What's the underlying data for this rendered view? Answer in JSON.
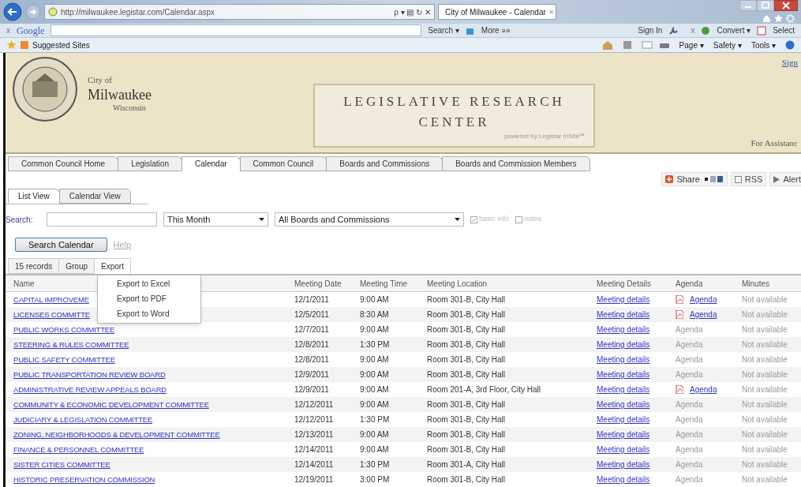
{
  "browser": {
    "url": "http://milwaukee.legistar.com/Calendar.aspx",
    "address_tools": "ρ ▾ ▤ ↻ ✕",
    "tab_title": "City of Milwaukee - Calendar",
    "tab_close": "×"
  },
  "google_toolbar": {
    "close": "x",
    "brand": "Google",
    "search_button": "Search ▾",
    "more": "More »»",
    "sign_in": "Sign In",
    "close_right": "x",
    "convert": "Convert ▾",
    "select": "Select"
  },
  "favorites_bar": {
    "suggested_sites": "Suggested Sites",
    "commands": [
      "Page ▾",
      "Safety ▾",
      "Tools ▾"
    ]
  },
  "banner": {
    "city_of": "City of",
    "city": "Milwaukee",
    "state": "Wisconsin",
    "title_line1": "LEGISLATIVE RESEARCH",
    "title_line2": "CENTER",
    "powered_by": "powered by Legistar InSite℠",
    "sign_in": "Sign",
    "assistance": "For Assistanc"
  },
  "nav_tabs": [
    {
      "label": "Common Council Home",
      "selected": false
    },
    {
      "label": "Legislation",
      "selected": false
    },
    {
      "label": "Calendar",
      "selected": true
    },
    {
      "label": "Common Council",
      "selected": false
    },
    {
      "label": "Boards and Commissions",
      "selected": false
    },
    {
      "label": "Boards and Commission Members",
      "selected": false
    }
  ],
  "share_bar": {
    "share": "Share",
    "rss": "RSS",
    "alerts": "Alert"
  },
  "view_tabs": [
    {
      "label": "List View",
      "selected": true
    },
    {
      "label": "Calendar View",
      "selected": false
    }
  ],
  "search": {
    "label": "Search:",
    "period": "This Month",
    "body": "All Boards and Commissions",
    "basic_info": {
      "label": "basic info",
      "checked": true
    },
    "notes": {
      "label": "notes",
      "checked": false
    },
    "button": "Search Calendar",
    "help": "Help"
  },
  "grid_toolbar": [
    {
      "label": "15 records",
      "selected": false
    },
    {
      "label": "Group",
      "selected": false
    },
    {
      "label": "Export",
      "selected": true
    }
  ],
  "export_menu": [
    "Export to Excel",
    "Export to PDF",
    "Export to Word"
  ],
  "table": {
    "columns": [
      "Name",
      "Meeting Date",
      "Meeting Time",
      "Meeting Location",
      "Meeting Details",
      "Agenda",
      "Minutes"
    ],
    "rows": [
      {
        "name": "CAPITAL IMPROVEME",
        "date": "12/1/2011",
        "time": "9:00 AM",
        "location": "Room 301-B, City Hall",
        "details": "Meeting details",
        "agenda": "Agenda",
        "agenda_available": true,
        "minutes": "Not available"
      },
      {
        "name": "LICENSES COMMITTE",
        "date": "12/5/2011",
        "time": "8:30 AM",
        "location": "Room 301-B, City Hall",
        "details": "Meeting details",
        "agenda": "Agenda",
        "agenda_available": true,
        "minutes": "Not available"
      },
      {
        "name": "PUBLIC WORKS COMMITTEE",
        "date": "12/7/2011",
        "time": "9:00 AM",
        "location": "Room 301-B, City Hall",
        "details": "Meeting details",
        "agenda": "Agenda",
        "agenda_available": false,
        "minutes": "Not available"
      },
      {
        "name": "STEERING & RULES COMMITTEE",
        "date": "12/8/2011",
        "time": "1:30 PM",
        "location": "Room 301-B, City Hall",
        "details": "Meeting details",
        "agenda": "Agenda",
        "agenda_available": false,
        "minutes": "Not available"
      },
      {
        "name": "PUBLIC SAFETY COMMITTEE",
        "date": "12/8/2011",
        "time": "9:00 AM",
        "location": "Room 301-B, City Hall",
        "details": "Meeting details",
        "agenda": "Agenda",
        "agenda_available": false,
        "minutes": "Not available"
      },
      {
        "name": "PUBLIC TRANSPORTATION REVIEW BOARD",
        "date": "12/9/2011",
        "time": "9:00 AM",
        "location": "Room 301-B, City Hall",
        "details": "Meeting details",
        "agenda": "Agenda",
        "agenda_available": false,
        "minutes": "Not available"
      },
      {
        "name": "ADMINISTRATIVE REVIEW APPEALS BOARD",
        "date": "12/9/2011",
        "time": "9:00 AM",
        "location": "Room 201-A, 3rd Floor, City Hall",
        "details": "Meeting details",
        "agenda": "Agenda",
        "agenda_available": true,
        "minutes": "Not available"
      },
      {
        "name": "COMMUNITY & ECONOMIC DEVELOPMENT COMMITTEE",
        "date": "12/12/2011",
        "time": "9:00 AM",
        "location": "Room 301-B, City Hall",
        "details": "Meeting details",
        "agenda": "Agenda",
        "agenda_available": false,
        "minutes": "Not available"
      },
      {
        "name": "JUDICIARY & LEGISLATION COMMITTEE",
        "date": "12/12/2011",
        "time": "1:30 PM",
        "location": "Room 301-B, City Hall",
        "details": "Meeting details",
        "agenda": "Agenda",
        "agenda_available": false,
        "minutes": "Not available"
      },
      {
        "name": "ZONING, NEIGHBORHOODS & DEVELOPMENT COMMITTEE",
        "date": "12/13/2011",
        "time": "9:00 AM",
        "location": "Room 301-B, City Hall",
        "details": "Meeting details",
        "agenda": "Agenda",
        "agenda_available": false,
        "minutes": "Not available"
      },
      {
        "name": "FINANCE & PERSONNEL COMMITTEE",
        "date": "12/14/2011",
        "time": "9:00 AM",
        "location": "Room 301-B, City Hall",
        "details": "Meeting details",
        "agenda": "Agenda",
        "agenda_available": false,
        "minutes": "Not available"
      },
      {
        "name": "SISTER CITIES COMMITTEE",
        "date": "12/14/2011",
        "time": "1:30 PM",
        "location": "Room 301-A, City Hall",
        "details": "Meeting details",
        "agenda": "Agenda",
        "agenda_available": false,
        "minutes": "Not available"
      },
      {
        "name": "HISTORIC PRESERVATION COMMISSION",
        "date": "12/19/2011",
        "time": "3:00 PM",
        "location": "Room 301-B, City Hall",
        "details": "Meeting details",
        "agenda": "Agenda",
        "agenda_available": false,
        "minutes": "Not available"
      }
    ]
  }
}
